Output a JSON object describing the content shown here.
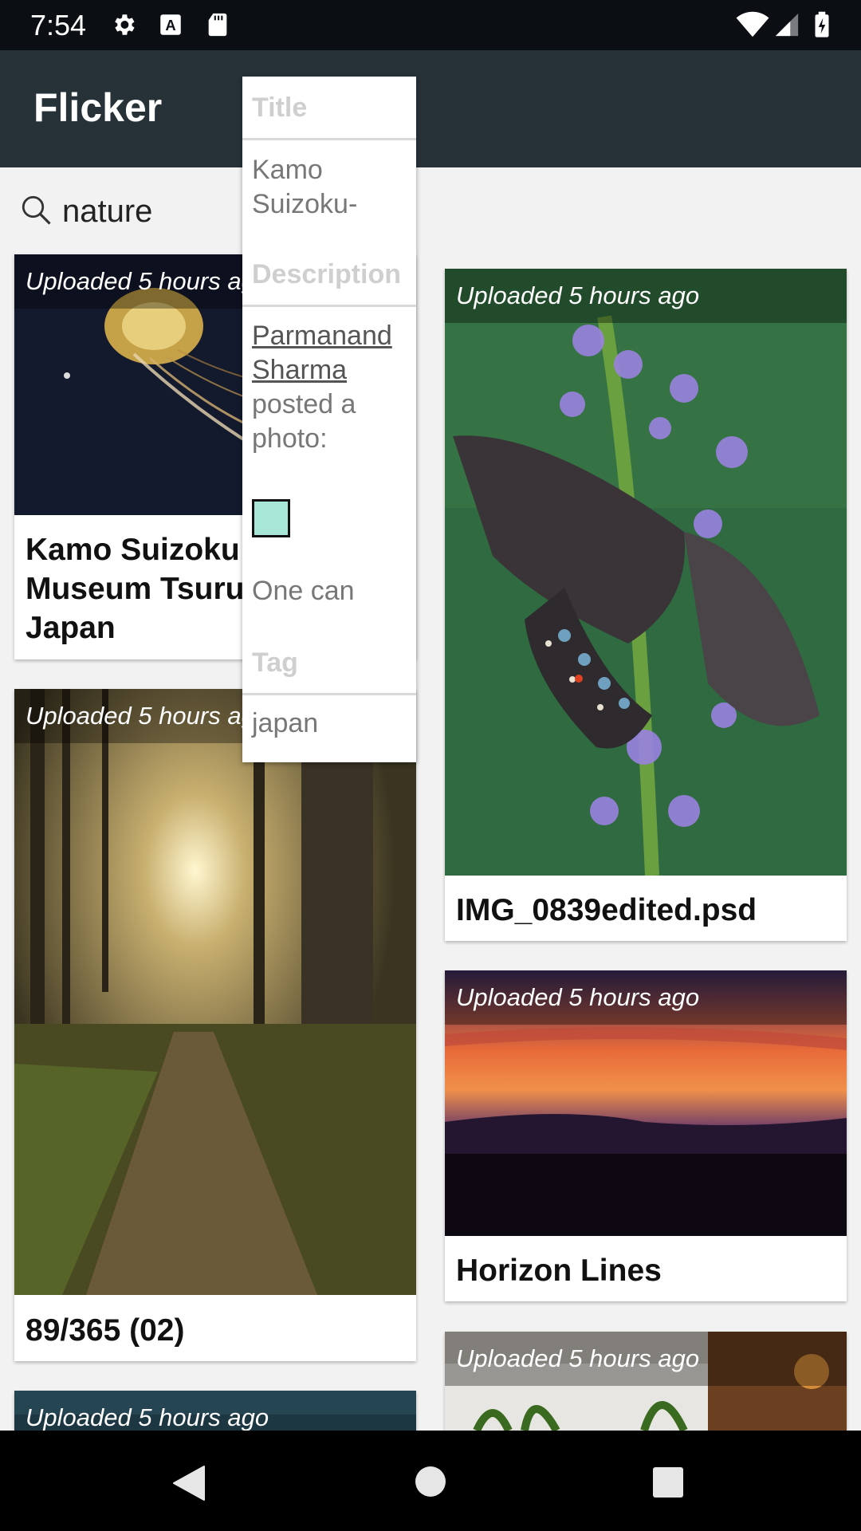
{
  "status_bar": {
    "time": "7:54",
    "icons": [
      "settings-icon",
      "accessibility-icon",
      "sd-card-icon",
      "wifi-icon",
      "signal-icon",
      "battery-icon"
    ]
  },
  "app_bar": {
    "title": "Flicker",
    "color": "#263238"
  },
  "search": {
    "value": "nature",
    "placeholder": ""
  },
  "cards": [
    {
      "uploaded": "Uploaded 5 hours ago",
      "title": "Kamo Suizoku Jellyfish Museum Tsuruoka, Japan"
    },
    {
      "uploaded": "Uploaded 5 hours ago",
      "title": "IMG_0839edited.psd"
    },
    {
      "uploaded": "Uploaded 5 hours ago",
      "title": "89/365 (02)"
    },
    {
      "uploaded": "Uploaded 5 hours ago",
      "title": "Horizon Lines"
    },
    {
      "uploaded": "Uploaded 5 hours ago",
      "title": ""
    },
    {
      "uploaded": "Uploaded 5 hours ago",
      "title": ""
    }
  ],
  "details": {
    "title_header": "Title",
    "title_value": "Kamo Suizoku-",
    "description_header": "Description",
    "description_author": "Parmanand Sharma",
    "description_text": "posted a photo:",
    "description_tail": "One can",
    "tag_header": "Tag",
    "tag_value": "japan",
    "swatch_color": "#a8e6d8"
  },
  "nav": {
    "icons": [
      "back-icon",
      "home-icon",
      "recents-icon"
    ]
  }
}
